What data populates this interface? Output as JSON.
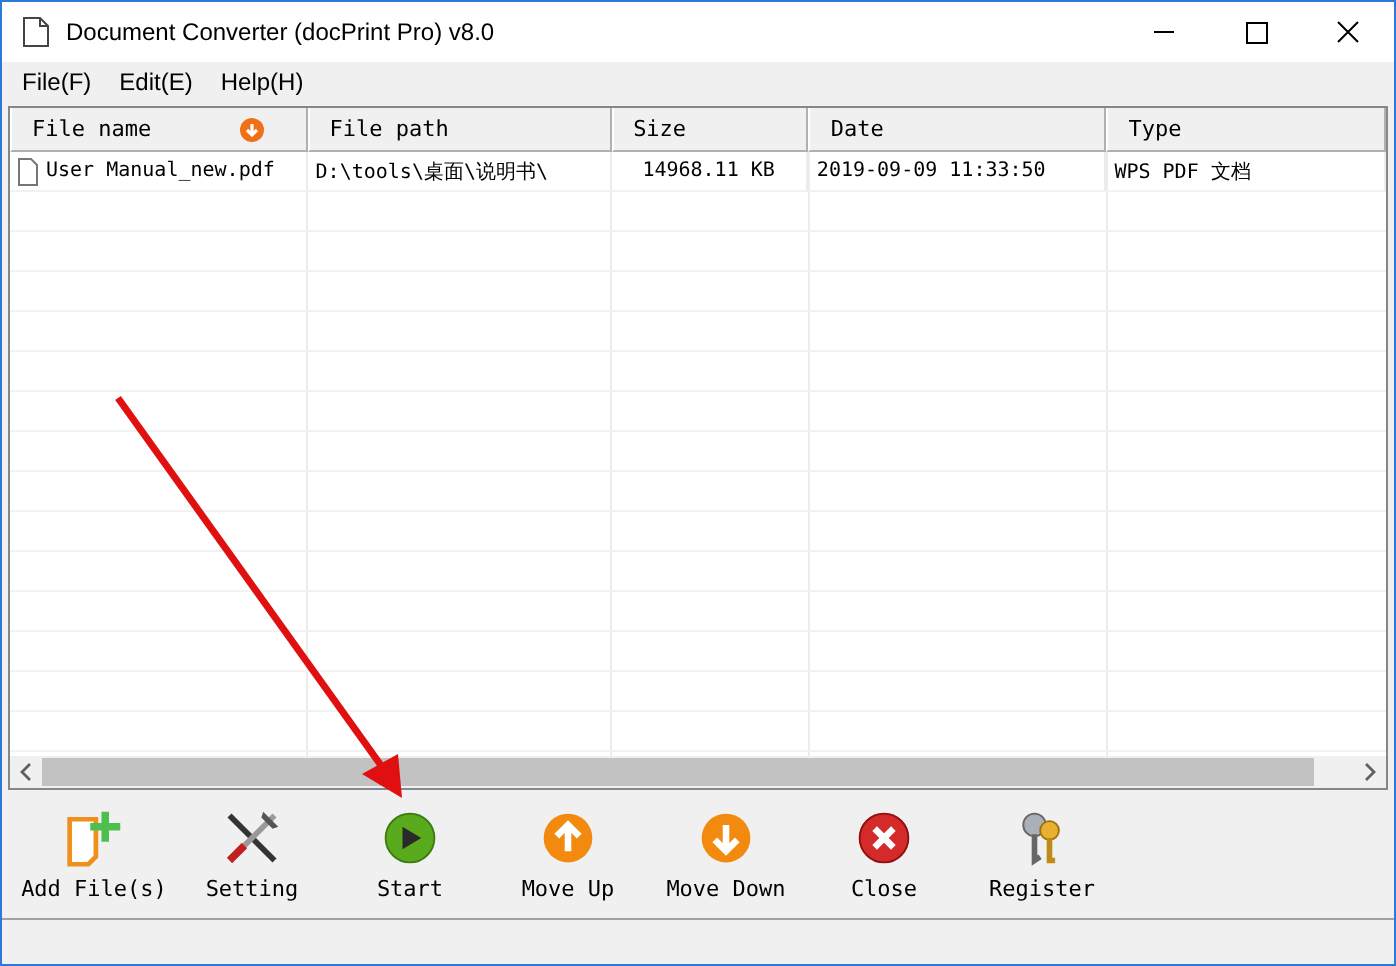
{
  "window": {
    "title": "Document Converter (docPrint Pro) v8.0"
  },
  "menu": [
    "File(F)",
    "Edit(E)",
    "Help(H)"
  ],
  "table": {
    "columns": [
      {
        "label": "File name",
        "sort": true
      },
      {
        "label": "File path",
        "sort": false
      },
      {
        "label": "Size",
        "sort": false
      },
      {
        "label": "Date",
        "sort": false
      },
      {
        "label": "Type",
        "sort": false
      }
    ],
    "rows": [
      {
        "cells": [
          "User Manual_new.pdf",
          "D:\\tools\\桌面\\说明书\\",
          "14968.11 KB",
          "2019-09-09 11:33:50",
          "WPS PDF 文档"
        ]
      }
    ]
  },
  "toolbar": [
    {
      "kind": "add",
      "label": "Add File(s)"
    },
    {
      "kind": "setting",
      "label": "Setting"
    },
    {
      "kind": "start",
      "label": "Start"
    },
    {
      "kind": "up",
      "label": "Move Up"
    },
    {
      "kind": "down",
      "label": "Move Down"
    },
    {
      "kind": "close",
      "label": "Close"
    },
    {
      "kind": "register",
      "label": "Register"
    }
  ]
}
